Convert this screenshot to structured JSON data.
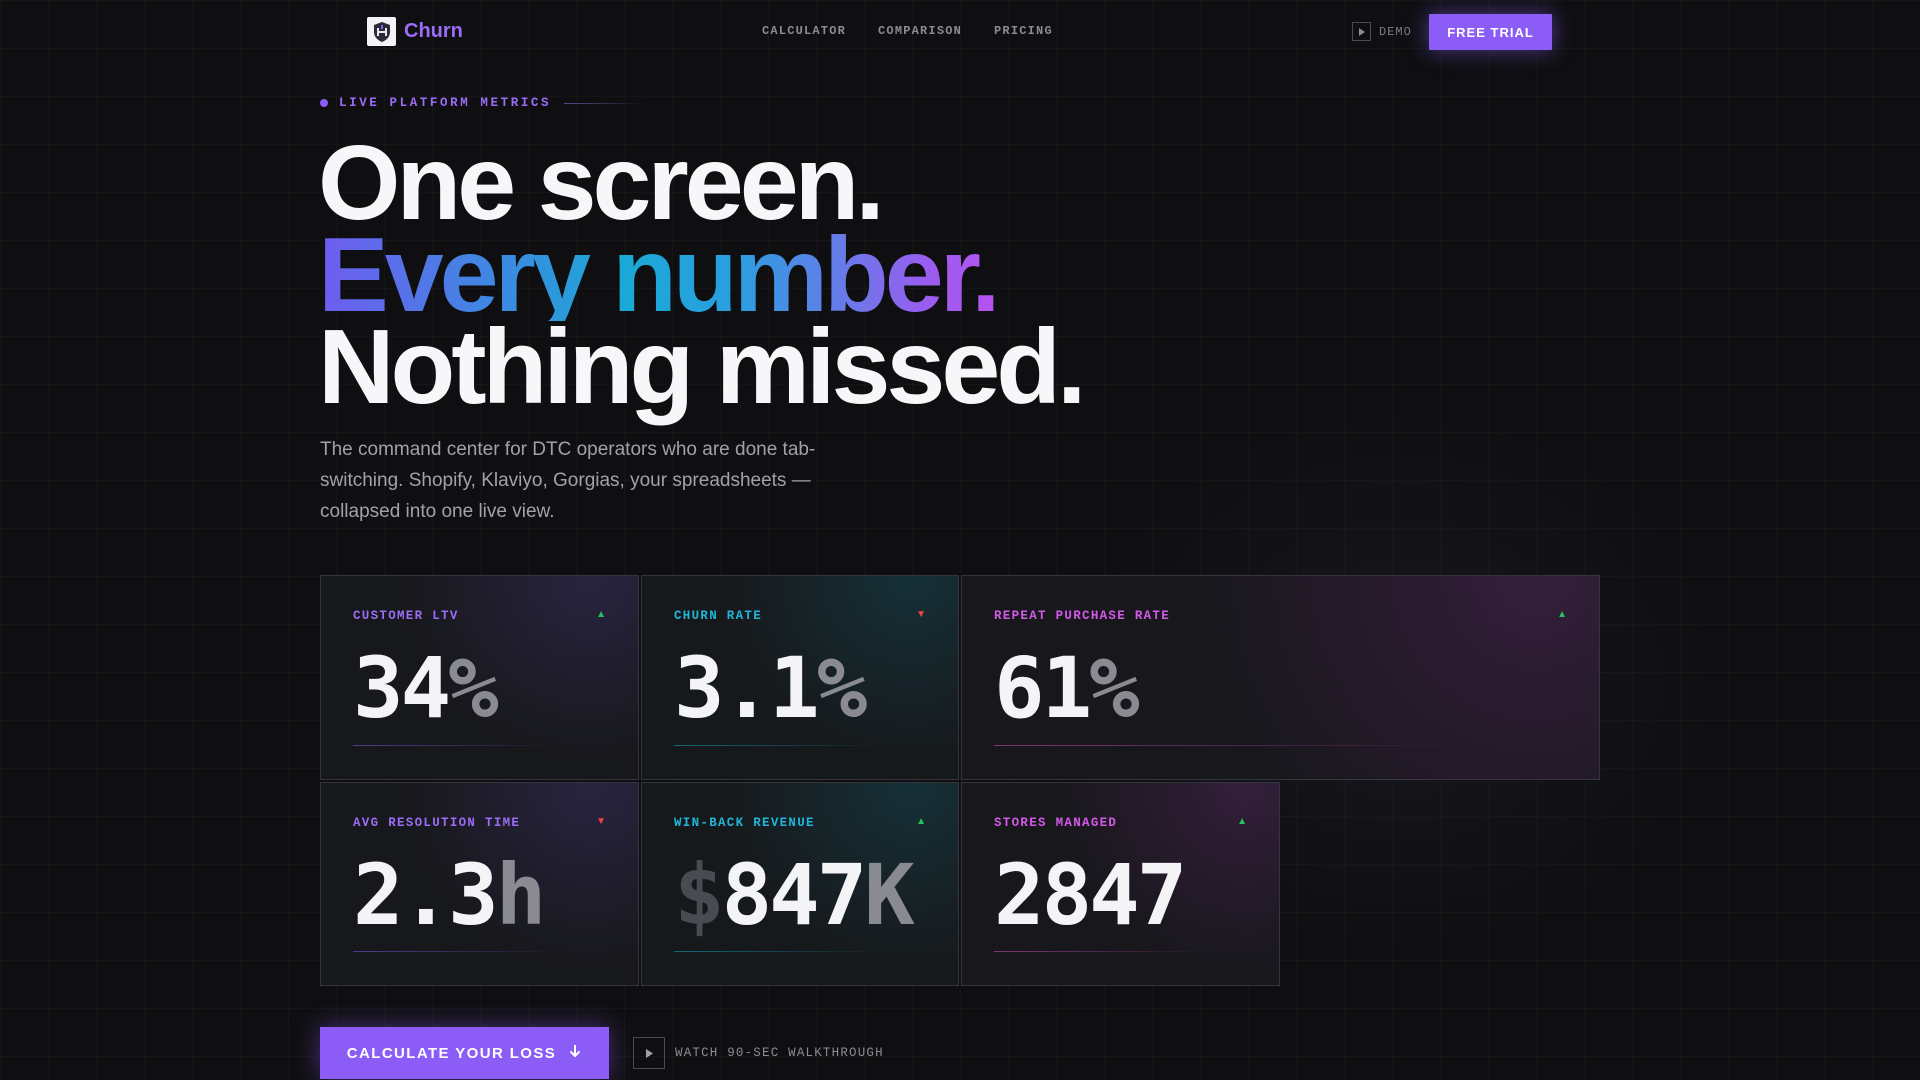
{
  "nav": {
    "brand": "Churn",
    "links": [
      "CALCULATOR",
      "COMPARISON",
      "PRICING"
    ],
    "demo_label": "DEMO",
    "trial_label": "FREE TRIAL"
  },
  "hero": {
    "eyebrow": "LIVE PLATFORM METRICS",
    "line1": "One screen.",
    "line2": "Every number.",
    "line3": "Nothing missed.",
    "subtext": "The command center for DTC operators who are done tab-switching. Shopify, Klaviyo, Gorgias, your spreadsheets — collapsed into one live view."
  },
  "metrics": [
    {
      "label": "CUSTOMER LTV",
      "value": "34",
      "suffix": "%",
      "trend": "▲"
    },
    {
      "label": "CHURN RATE",
      "value": "3.1",
      "suffix": "%",
      "trend": "▼"
    },
    {
      "label": "REPEAT PURCHASE RATE",
      "value": "61",
      "suffix": "%",
      "trend": "▲"
    },
    {
      "label": "AVG RESOLUTION TIME",
      "value": "2.3",
      "suffix": "h",
      "trend": "▼"
    },
    {
      "label": "WIN-BACK REVENUE",
      "prefix": "$",
      "value": "847",
      "suffix": "K",
      "trend": "▲"
    },
    {
      "label": "STORES MANAGED",
      "value": "2847",
      "trend": "▲"
    }
  ],
  "cta": {
    "primary_label": "CALCULATE YOUR LOSS",
    "secondary_label": "WATCH 90-SEC WALKTHROUGH"
  },
  "colors": {
    "accent": "#8b5cf6",
    "cyan": "#22b5d8",
    "pink": "#d25ae8",
    "trend_up": "#22c55e",
    "trend_down": "#ef4444"
  },
  "icons": {
    "logo": "shield-logo-icon",
    "demo": "play-icon",
    "cta": "arrow-down-icon",
    "watch": "play-icon"
  }
}
